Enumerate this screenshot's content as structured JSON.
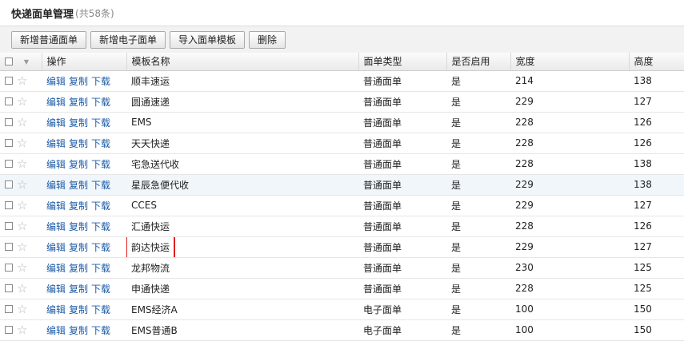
{
  "page": {
    "title": "快递面单管理",
    "count": "(共58条)"
  },
  "toolbar": {
    "new_normal": "新增普通面单",
    "new_electronic": "新增电子面单",
    "import_template": "导入面单模板",
    "delete": "删除"
  },
  "table": {
    "headers": {
      "actions": "操作",
      "template_name": "模板名称",
      "type": "面单类型",
      "enabled": "是否启用",
      "width": "宽度",
      "height": "高度"
    },
    "action_labels": {
      "edit": "编辑",
      "copy": "复制",
      "download": "下载"
    },
    "rows": [
      {
        "name": "顺丰速运",
        "type": "普通面单",
        "enabled": "是",
        "width": "214",
        "height": "138"
      },
      {
        "name": "圆通速递",
        "type": "普通面单",
        "enabled": "是",
        "width": "229",
        "height": "127"
      },
      {
        "name": "EMS",
        "type": "普通面单",
        "enabled": "是",
        "width": "228",
        "height": "126"
      },
      {
        "name": "天天快递",
        "type": "普通面单",
        "enabled": "是",
        "width": "228",
        "height": "126"
      },
      {
        "name": "宅急送代收",
        "type": "普通面单",
        "enabled": "是",
        "width": "228",
        "height": "138"
      },
      {
        "name": "星辰急便代收",
        "type": "普通面单",
        "enabled": "是",
        "width": "229",
        "height": "138"
      },
      {
        "name": "CCES",
        "type": "普通面单",
        "enabled": "是",
        "width": "229",
        "height": "127"
      },
      {
        "name": "汇通快运",
        "type": "普通面单",
        "enabled": "是",
        "width": "228",
        "height": "126"
      },
      {
        "name": "韵达快运",
        "type": "普通面单",
        "enabled": "是",
        "width": "229",
        "height": "127"
      },
      {
        "name": "龙邦物流",
        "type": "普通面单",
        "enabled": "是",
        "width": "230",
        "height": "125"
      },
      {
        "name": "申通快递",
        "type": "普通面单",
        "enabled": "是",
        "width": "228",
        "height": "125"
      },
      {
        "name": "EMS经济A",
        "type": "电子面单",
        "enabled": "是",
        "width": "100",
        "height": "150"
      },
      {
        "name": "EMS普通B",
        "type": "电子面单",
        "enabled": "是",
        "width": "100",
        "height": "150"
      }
    ]
  }
}
